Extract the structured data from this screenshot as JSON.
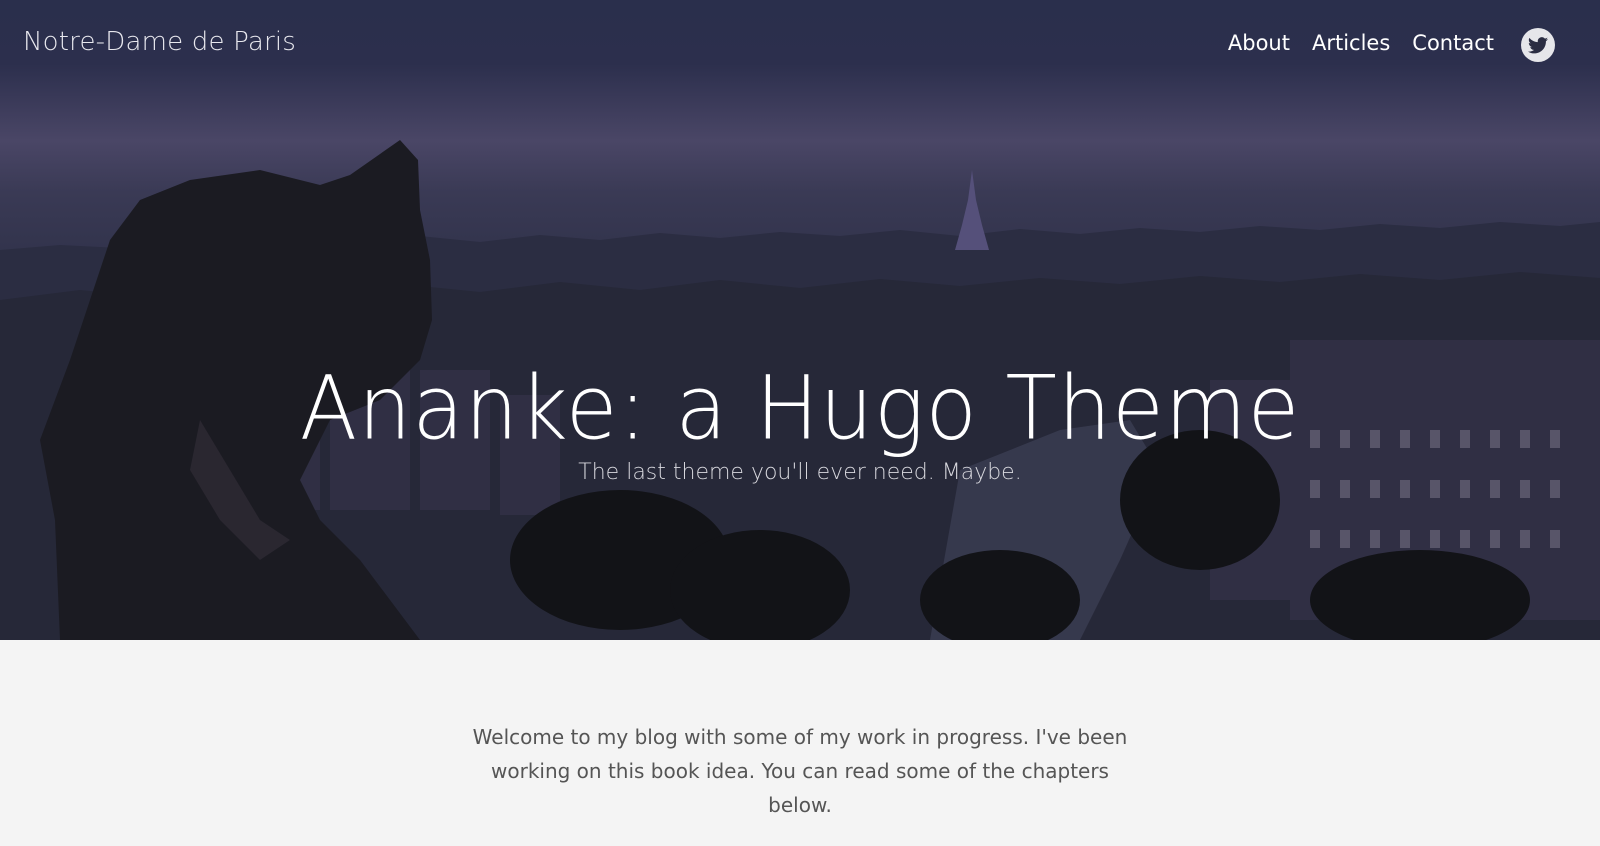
{
  "header": {
    "brand": "Notre-Dame de Paris",
    "nav": [
      {
        "label": "About"
      },
      {
        "label": "Articles"
      },
      {
        "label": "Contact"
      }
    ],
    "social_icon": "twitter-icon"
  },
  "hero": {
    "title": "Ananke: a Hugo Theme",
    "subtitle": "The last theme you'll ever need. Maybe."
  },
  "main": {
    "intro": "Welcome to my blog with some of my work in progress. I've been working on this book idea. You can read some of the chapters below."
  },
  "colors": {
    "hero_overlay": "#2c2f4d",
    "page_background": "#f4f4f4",
    "body_text": "#555555"
  }
}
